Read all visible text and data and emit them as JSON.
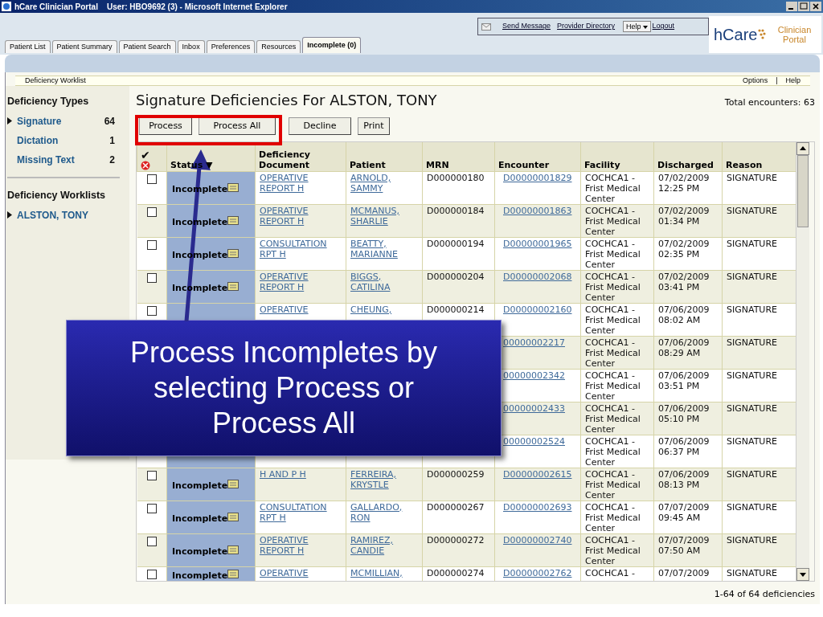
{
  "window": {
    "title": "hCare Clinician Portal    User: HBO9692 (3) - Microsoft Internet Explorer"
  },
  "header": {
    "links": [
      "Send Message",
      "Provider Directory"
    ],
    "help": "Help",
    "logout": "Logout",
    "logo": "hCare",
    "logo_caption": "Clinician Portal"
  },
  "tabs": [
    {
      "label": "Patient List",
      "selected": false
    },
    {
      "label": "Patient Summary",
      "selected": false
    },
    {
      "label": "Patient Search",
      "selected": false
    },
    {
      "label": "Inbox",
      "selected": false
    },
    {
      "label": "Preferences",
      "selected": false
    },
    {
      "label": "Resources",
      "selected": false
    },
    {
      "label": "Incomplete (0)",
      "selected": true
    }
  ],
  "breadcrumb": "Deficiency Worklist",
  "top_links": [
    "Options",
    "|",
    "Help"
  ],
  "sidebar": {
    "types_heading": "Deficiency Types",
    "types": [
      {
        "label": "Signature",
        "count": "64",
        "selected": true
      },
      {
        "label": "Dictation",
        "count": "1",
        "selected": false
      },
      {
        "label": "Missing Text",
        "count": "2",
        "selected": false
      }
    ],
    "worklists_heading": "Deficiency Worklists",
    "worklists": [
      {
        "label": "ALSTON, TONY",
        "selected": true
      }
    ]
  },
  "main": {
    "title": "Signature Deficiencies For ALSTON, TONY",
    "total": "Total encounters: 63",
    "buttons": [
      "Process",
      "Process All",
      "Decline",
      "Print"
    ],
    "columns": [
      "✔",
      "Status ▼",
      "Deficiency Document",
      "Patient",
      "MRN",
      "Encounter",
      "Facility",
      "Discharged",
      "Reason"
    ],
    "rows": [
      {
        "checked": false,
        "status": "Incomplete",
        "document": "OPERATIVE REPORT H",
        "patient": "ARNOLD, SAMMY",
        "mrn": "D000000180",
        "encounter": "D00000001829",
        "facility": "COCHCA1 - Frist Medical Center",
        "discharged": "07/02/2009 12:25 PM",
        "reason": "SIGNATURE"
      },
      {
        "checked": false,
        "status": "Incomplete",
        "document": "OPERATIVE REPORT H",
        "patient": "MCMANUS, SHARLIE",
        "mrn": "D000000184",
        "encounter": "D00000001863",
        "facility": "COCHCA1 - Frist Medical Center",
        "discharged": "07/02/2009 01:34 PM",
        "reason": "SIGNATURE"
      },
      {
        "checked": false,
        "status": "Incomplete",
        "document": "CONSULTATION RPT H",
        "patient": "BEATTY, MARIANNE",
        "mrn": "D000000194",
        "encounter": "D00000001965",
        "facility": "COCHCA1 - Frist Medical Center",
        "discharged": "07/02/2009 02:35 PM",
        "reason": "SIGNATURE"
      },
      {
        "checked": false,
        "status": "Incomplete",
        "document": "OPERATIVE REPORT H",
        "patient": "BIGGS, CATILINA",
        "mrn": "D000000204",
        "encounter": "D00000002068",
        "facility": "COCHCA1 - Frist Medical Center",
        "discharged": "07/02/2009 03:41 PM",
        "reason": "SIGNATURE"
      },
      {
        "checked": false,
        "document": "OPERATIVE",
        "patient": "CHEUNG,",
        "mrn": "D000000214",
        "encounter": "D00000002160",
        "facility": "COCHCA1 - Frist Medical Center",
        "discharged": "07/06/2009 08:02 AM",
        "reason": "SIGNATURE"
      },
      {
        "encounter": "00000002217",
        "facility": "COCHCA1 - Frist Medical Center",
        "discharged": "07/06/2009 08:29 AM",
        "reason": "SIGNATURE"
      },
      {
        "encounter": "00000002342",
        "facility": "COCHCA1 - Frist Medical Center",
        "discharged": "07/06/2009 03:51 PM",
        "reason": "SIGNATURE"
      },
      {
        "encounter": "00000002433",
        "facility": "COCHCA1 - Frist Medical Center",
        "discharged": "07/06/2009 05:10 PM",
        "reason": "SIGNATURE"
      },
      {
        "encounter": "00000002524",
        "facility": "COCHCA1 - Frist Medical Center",
        "discharged": "07/06/2009 06:37 PM",
        "reason": "SIGNATURE"
      },
      {
        "checked": false,
        "status": "Incomplete",
        "document": "H AND P H",
        "patient": "FERREIRA, KRYSTLE",
        "mrn": "D000000259",
        "encounter": "D00000002615",
        "facility": "COCHCA1 - Frist Medical Center",
        "discharged": "07/06/2009 08:13 PM",
        "reason": "SIGNATURE"
      },
      {
        "checked": false,
        "status": "Incomplete",
        "document": "CONSULTATION RPT H",
        "patient": "GALLARDO, RON",
        "mrn": "D000000267",
        "encounter": "D00000002693",
        "facility": "COCHCA1 - Frist Medical Center",
        "discharged": "07/07/2009 09:45 AM",
        "reason": "SIGNATURE"
      },
      {
        "checked": false,
        "status": "Incomplete",
        "document": "OPERATIVE REPORT H",
        "patient": "RAMIREZ, CANDIE",
        "mrn": "D000000272",
        "encounter": "D00000002740",
        "facility": "COCHCA1 - Frist Medical Center",
        "discharged": "07/07/2009 07:50 AM",
        "reason": "SIGNATURE"
      },
      {
        "checked": false,
        "status": "Incomplete",
        "document": "OPERATIVE",
        "patient": "MCMILLIAN,",
        "mrn": "D000000274",
        "encounter": "D00000002762",
        "facility": "COCHCA1 -",
        "discharged": "07/07/2009",
        "reason": "SIGNATURE"
      }
    ],
    "footer": "1-64 of 64 deficiencies"
  },
  "callout": {
    "text": "Process Incompletes by selecting Process or Process All"
  }
}
